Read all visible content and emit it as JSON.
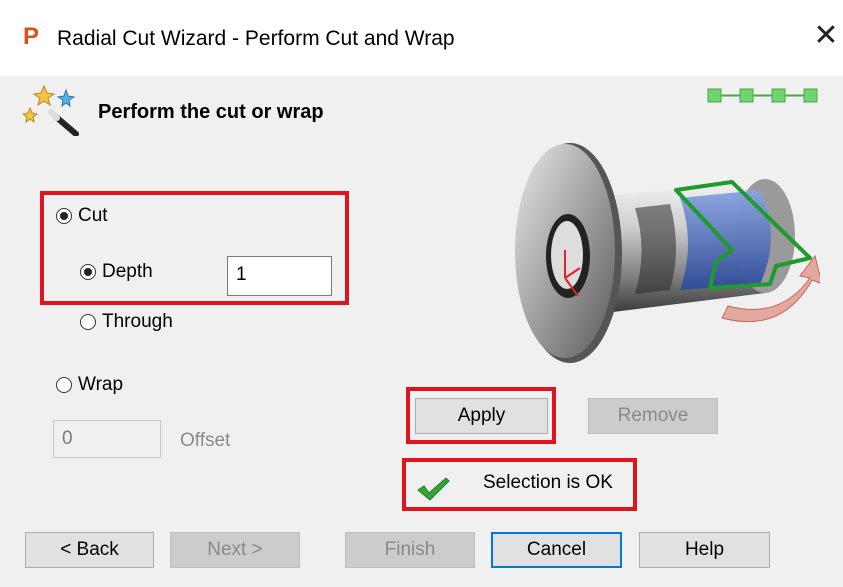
{
  "window": {
    "title": "Radial Cut Wizard - Perform Cut and Wrap",
    "app_icon_letter": "P",
    "close_glyph": "✕"
  },
  "header": {
    "heading": "Perform the cut or wrap",
    "steps_total": 4
  },
  "options": {
    "cut_label": "Cut",
    "depth_label": "Depth",
    "depth_value": "1",
    "through_label": "Through",
    "wrap_label": "Wrap",
    "offset_value": "0",
    "offset_label": "Offset",
    "selected_mode": "Cut",
    "selected_cut_type": "Depth"
  },
  "actions": {
    "apply_label": "Apply",
    "remove_label": "Remove"
  },
  "status": {
    "text": "Selection is OK",
    "icon": "checkmark-icon"
  },
  "footer": {
    "back_label": "< Back",
    "next_label": "Next >",
    "finish_label": "Finish",
    "cancel_label": "Cancel",
    "help_label": "Help"
  },
  "colors": {
    "highlight": "#e0141e",
    "step_green": "#6fd36f",
    "accent": "#0078d7"
  }
}
